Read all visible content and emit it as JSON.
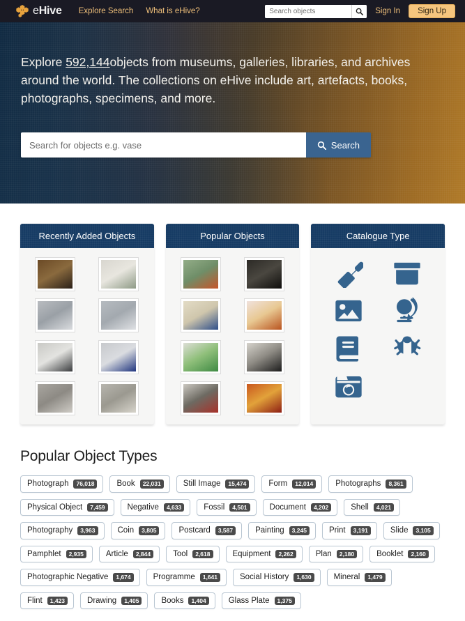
{
  "brand": {
    "name_light": "e",
    "name_bold": "Hive",
    "logo_icon": "honeycomb-hex-logo"
  },
  "topnav": {
    "links": [
      {
        "label": "Explore Search"
      },
      {
        "label": "What is eHive?"
      }
    ],
    "search": {
      "placeholder": "Search objects",
      "value": "",
      "icon": "search-icon"
    },
    "signin_label": "Sign In",
    "signup_label": "Sign Up"
  },
  "hero": {
    "text_before": "Explore ",
    "count": "592,144",
    "text_after": "objects from museums, galleries, libraries, and archives around the world. The collections on eHive include art, artefacts, books, photographs, specimens, and more.",
    "search": {
      "placeholder": "Search for objects e.g. vase",
      "value": "",
      "button_label": "Search",
      "button_icon": "search-icon"
    },
    "gradient_from": "#102a42",
    "gradient_to": "#b07a28"
  },
  "cards": [
    {
      "title": "Recently Added Objects",
      "kind": "thumbnails",
      "thumbs": [
        {
          "name": "framed-portrait-photograph",
          "colors": [
            "#6b4a26",
            "#2b2018",
            "#8a6a3e"
          ]
        },
        {
          "name": "syringe-boxed-set",
          "colors": [
            "#d8d6cf",
            "#8e9a86",
            "#e8e6df"
          ]
        },
        {
          "name": "glass-syringe",
          "colors": [
            "#b9bcc0",
            "#d9dbde",
            "#9aa0a6"
          ]
        },
        {
          "name": "hypodermic-syringe",
          "colors": [
            "#b6bbc0",
            "#dfe1e4",
            "#a3a9af"
          ]
        },
        {
          "name": "medical-instrument-case",
          "colors": [
            "#c9c9c5",
            "#3a3c3e",
            "#e3e3e0"
          ]
        },
        {
          "name": "blue-instrument-tray",
          "colors": [
            "#c7c9cc",
            "#20357f",
            "#dadce0"
          ]
        },
        {
          "name": "syringe-on-stand",
          "colors": [
            "#a9a6a0",
            "#cfccc6",
            "#8d8a84"
          ]
        },
        {
          "name": "metal-tins-and-label",
          "colors": [
            "#b7b5ae",
            "#d7d4cb",
            "#9b9990"
          ]
        }
      ]
    },
    {
      "title": "Popular Objects",
      "kind": "thumbnails",
      "thumbs": [
        {
          "name": "green-hardback-book",
          "colors": [
            "#93ad88",
            "#c7552a",
            "#6f8e68"
          ]
        },
        {
          "name": "vintage-shop-photograph",
          "colors": [
            "#2c2a26",
            "#0f0e0c",
            "#4a4740"
          ]
        },
        {
          "name": "handwritten-manuscript",
          "colors": [
            "#e3dcc6",
            "#2f4f8a",
            "#cfc6ac"
          ]
        },
        {
          "name": "amber-apothecary-bottle",
          "colors": [
            "#f0e2dd",
            "#b9541f",
            "#e8c892"
          ]
        },
        {
          "name": "green-glass-bottle",
          "colors": [
            "#ddded6",
            "#3f8a43",
            "#8fbf7a"
          ]
        },
        {
          "name": "cottage-house-photograph",
          "colors": [
            "#d6d3cc",
            "#1c1c1c",
            "#8e8b84"
          ]
        },
        {
          "name": "red-handled-tool",
          "colors": [
            "#cbc8c1",
            "#a8322a",
            "#6d6a62"
          ]
        },
        {
          "name": "red-cast-iron-machine",
          "colors": [
            "#c9581e",
            "#8e1f14",
            "#e2a23a"
          ]
        }
      ]
    },
    {
      "title": "Catalogue Type",
      "kind": "icons",
      "icons": [
        {
          "name": "trowel-icon",
          "label": "Archaeology"
        },
        {
          "name": "archive-box-icon",
          "label": "Archive"
        },
        {
          "name": "photo-image-icon",
          "label": "Image"
        },
        {
          "name": "globe-icon",
          "label": "Natural Science"
        },
        {
          "name": "book-icon",
          "label": "Library"
        },
        {
          "name": "insect-bug-icon",
          "label": "Entomology"
        },
        {
          "name": "camera-icon",
          "label": "Photography"
        }
      ],
      "icon_color": "#35648e"
    }
  ],
  "types": {
    "title": "Popular Object Types",
    "tags": [
      {
        "label": "Photograph",
        "count": "76,018"
      },
      {
        "label": "Book",
        "count": "22,031"
      },
      {
        "label": "Still Image",
        "count": "15,474"
      },
      {
        "label": "Form",
        "count": "12,014"
      },
      {
        "label": "Photographs",
        "count": "8,361"
      },
      {
        "label": "Physical Object",
        "count": "7,459"
      },
      {
        "label": "Negative",
        "count": "4,633"
      },
      {
        "label": "Fossil",
        "count": "4,501"
      },
      {
        "label": "Document",
        "count": "4,202"
      },
      {
        "label": "Shell",
        "count": "4,021"
      },
      {
        "label": "Photography",
        "count": "3,963"
      },
      {
        "label": "Coin",
        "count": "3,805"
      },
      {
        "label": "Postcard",
        "count": "3,587"
      },
      {
        "label": "Painting",
        "count": "3,245"
      },
      {
        "label": "Print",
        "count": "3,191"
      },
      {
        "label": "Slide",
        "count": "3,105"
      },
      {
        "label": "Pamphlet",
        "count": "2,935"
      },
      {
        "label": "Article",
        "count": "2,844"
      },
      {
        "label": "Tool",
        "count": "2,618"
      },
      {
        "label": "Equipment",
        "count": "2,262"
      },
      {
        "label": "Plan",
        "count": "2,180"
      },
      {
        "label": "Booklet",
        "count": "2,160"
      },
      {
        "label": "Photographic Negative",
        "count": "1,674"
      },
      {
        "label": "Programme",
        "count": "1,641"
      },
      {
        "label": "Social History",
        "count": "1,630"
      },
      {
        "label": "Mineral",
        "count": "1,479"
      },
      {
        "label": "Flint",
        "count": "1,423"
      },
      {
        "label": "Drawing",
        "count": "1,405"
      },
      {
        "label": "Books",
        "count": "1,404"
      },
      {
        "label": "Glass Plate",
        "count": "1,375"
      }
    ]
  },
  "colors": {
    "nav_bg": "#1a1a24",
    "nav_link": "#f0c07a",
    "signup_bg": "#f5c57e",
    "card_header": "#163b64",
    "search_button": "#3a6490",
    "tag_border": "#b9c6d2",
    "tag_count_bg": "#4a4a4a"
  }
}
